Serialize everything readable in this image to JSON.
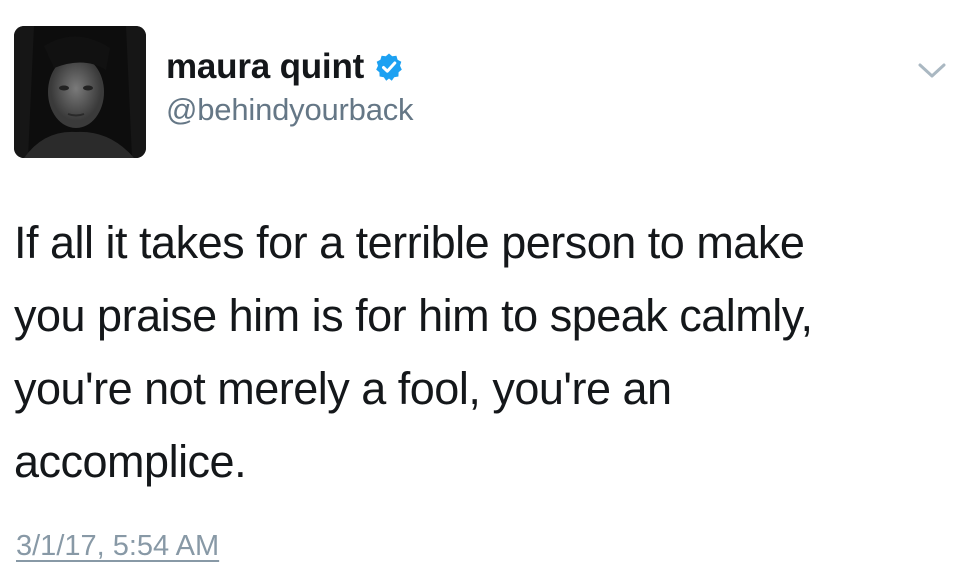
{
  "author": {
    "display_name": "maura quint",
    "handle": "@behindyourback",
    "verified": true,
    "avatar_icon": "user-avatar-photo"
  },
  "tweet": {
    "text": "If all it takes for a terrible person to make you praise him is for him to speak calmly, you're not merely a fool, you're an accomplice.",
    "lines": [
      "If all it takes for a terrible person to make",
      "you praise him is for him to speak calmly,",
      "you're not merely a fool, you're an",
      "accomplice."
    ],
    "timestamp": "3/1/17, 5:54 AM"
  },
  "icons": {
    "verified": "verified-badge-icon",
    "menu": "chevron-down-icon"
  },
  "colors": {
    "verified_blue": "#1da1f2",
    "handle_gray": "#657786",
    "timestamp_gray": "#8899a6",
    "text": "#14171a"
  }
}
